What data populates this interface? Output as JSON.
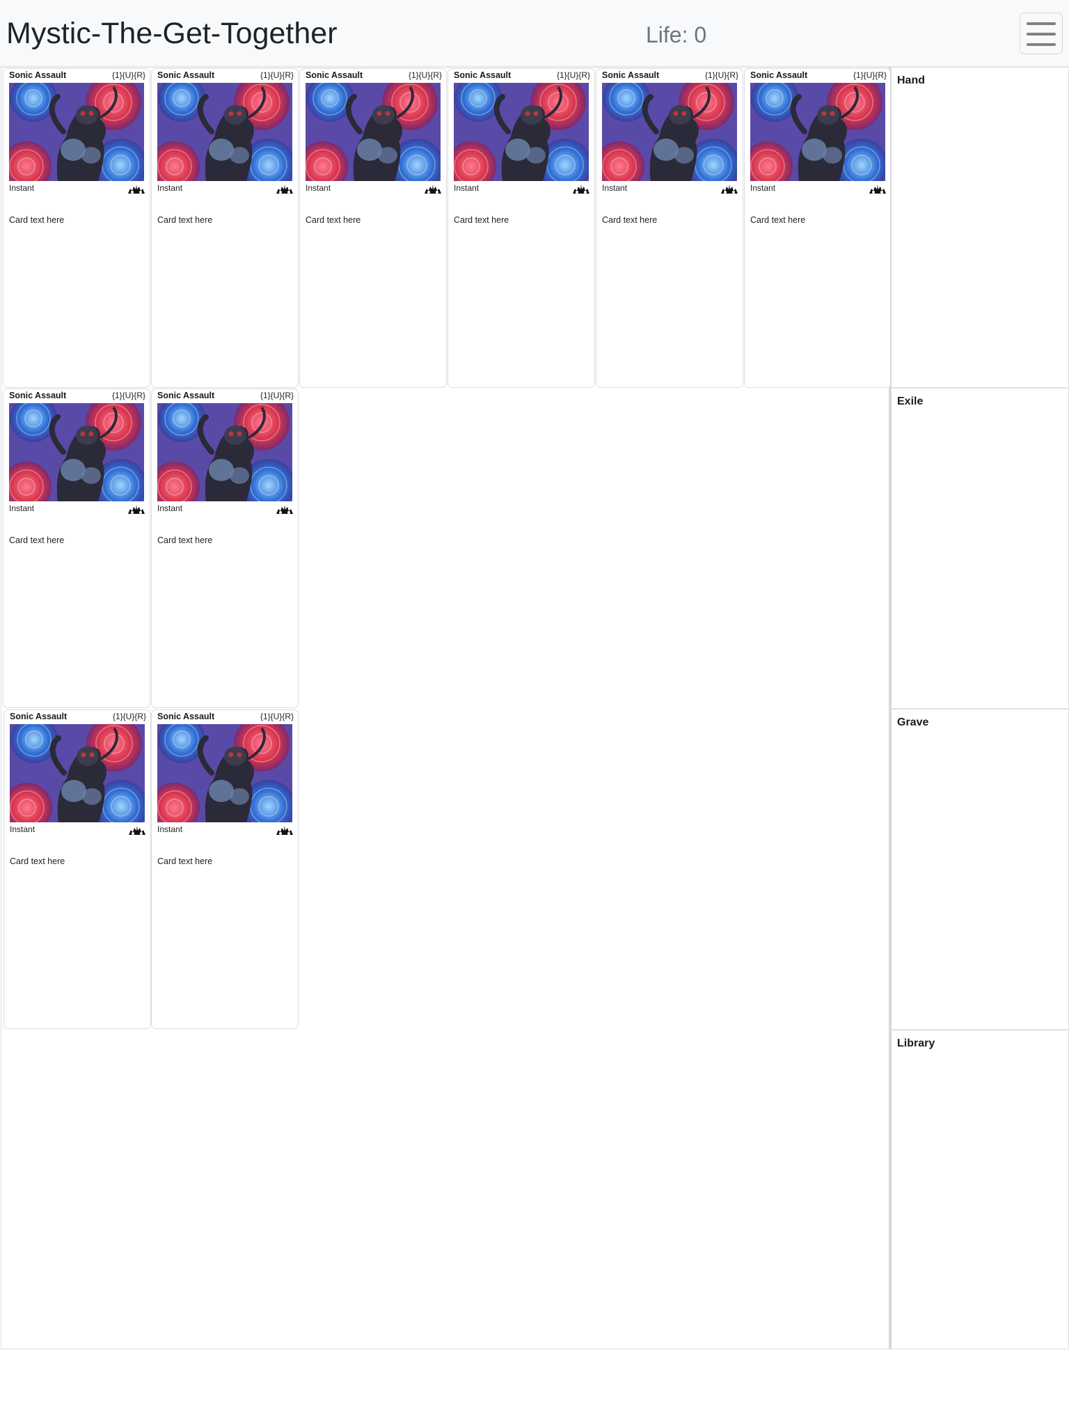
{
  "app": {
    "title": "Mystic-The-Get-Together",
    "life": "Life: 0",
    "menu_icon": "hamburger-menu-icon"
  },
  "battlefield": {
    "cards": [
      {
        "name": "Sonic Assault",
        "cost": "{1}{U}{R}",
        "type": "Instant",
        "text": "Card text here",
        "set_icon": "set-symbol-icon"
      },
      {
        "name": "Sonic Assault",
        "cost": "{1}{U}{R}",
        "type": "Instant",
        "text": "Card text here",
        "set_icon": "set-symbol-icon"
      },
      {
        "name": "Sonic Assault",
        "cost": "{1}{U}{R}",
        "type": "Instant",
        "text": "Card text here",
        "set_icon": "set-symbol-icon"
      },
      {
        "name": "Sonic Assault",
        "cost": "{1}{U}{R}",
        "type": "Instant",
        "text": "Card text here",
        "set_icon": "set-symbol-icon"
      },
      {
        "name": "Sonic Assault",
        "cost": "{1}{U}{R}",
        "type": "Instant",
        "text": "Card text here",
        "set_icon": "set-symbol-icon"
      },
      {
        "name": "Sonic Assault",
        "cost": "{1}{U}{R}",
        "type": "Instant",
        "text": "Card text here",
        "set_icon": "set-symbol-icon"
      },
      {
        "name": "Sonic Assault",
        "cost": "{1}{U}{R}",
        "type": "Instant",
        "text": "Card text here",
        "set_icon": "set-symbol-icon"
      },
      {
        "name": "Sonic Assault",
        "cost": "{1}{U}{R}",
        "type": "Instant",
        "text": "Card text here",
        "set_icon": "set-symbol-icon"
      },
      {
        "name": "Sonic Assault",
        "cost": "{1}{U}{R}",
        "type": "Instant",
        "text": "Card text here",
        "set_icon": "set-symbol-icon"
      },
      {
        "name": "Sonic Assault",
        "cost": "{1}{U}{R}",
        "type": "Instant",
        "text": "Card text here",
        "set_icon": "set-symbol-icon"
      }
    ]
  },
  "zones": {
    "hand": {
      "title": "Hand"
    },
    "exile": {
      "title": "Exile"
    },
    "grave": {
      "title": "Grave"
    },
    "library": {
      "title": "Library"
    }
  },
  "colors": {
    "navbar_bg": "#f8f9fa",
    "border": "#dcdfe2",
    "art_red": "#d8344d",
    "art_blue": "#2f6fd6"
  }
}
